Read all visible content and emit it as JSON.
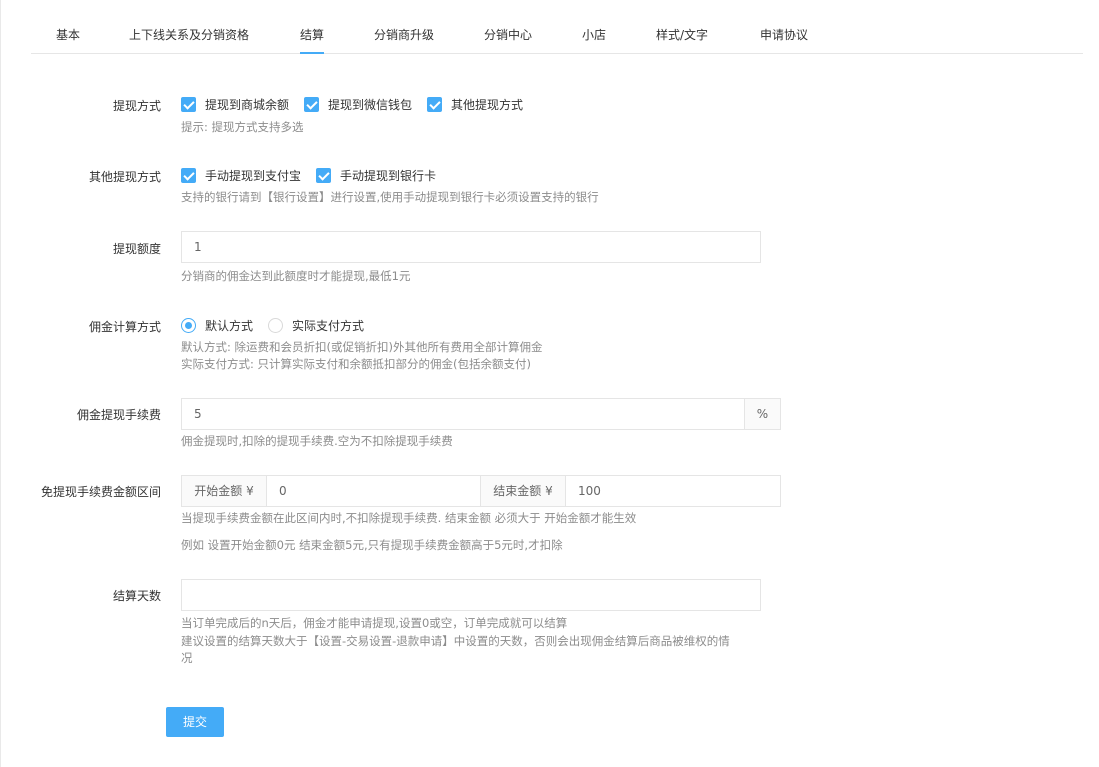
{
  "tabs": [
    {
      "label": "基本"
    },
    {
      "label": "上下线关系及分销资格"
    },
    {
      "label": "结算"
    },
    {
      "label": "分销商升级"
    },
    {
      "label": "分销中心"
    },
    {
      "label": "小店"
    },
    {
      "label": "样式/文字"
    },
    {
      "label": "申请协议"
    }
  ],
  "active_tab": "结算",
  "accent_color": "#44abf7",
  "form": {
    "withdraw_method": {
      "label": "提现方式",
      "options": [
        "提现到商城余额",
        "提现到微信钱包",
        "其他提现方式"
      ],
      "checked": [
        true,
        true,
        true
      ],
      "help": "提示: 提现方式支持多选"
    },
    "other_withdraw": {
      "label": "其他提现方式",
      "options": [
        "手动提现到支付宝",
        "手动提现到银行卡"
      ],
      "checked": [
        true,
        true
      ],
      "help": "支持的银行请到【银行设置】进行设置,使用手动提现到银行卡必须设置支持的银行"
    },
    "withdraw_amount": {
      "label": "提现额度",
      "value": "1",
      "help": "分销商的佣金达到此额度时才能提现,最低1元"
    },
    "commission_calc": {
      "label": "佣金计算方式",
      "options": [
        "默认方式",
        "实际支付方式"
      ],
      "selected": "默认方式",
      "help1": "默认方式: 除运费和会员折扣(或促销折扣)外其他所有费用全部计算佣金",
      "help2": "实际支付方式: 只计算实际支付和余额抵扣部分的佣金(包括余额支付)"
    },
    "withdraw_fee": {
      "label": "佣金提现手续费",
      "value": "5",
      "suffix": "%",
      "help": "佣金提现时,扣除的提现手续费.空为不扣除提现手续费"
    },
    "fee_free_range": {
      "label": "免提现手续费金额区间",
      "start_label": "开始金额 ¥",
      "start_value": "0",
      "end_label": "结束金额 ¥",
      "end_value": "100",
      "help1": "当提现手续费金额在此区间内时,不扣除提现手续费. 结束金额 必须大于 开始金额才能生效",
      "help2": "例如 设置开始金额0元 结束金额5元,只有提现手续费金额高于5元时,才扣除"
    },
    "settle_days": {
      "label": "结算天数",
      "value": "",
      "help1": "当订单完成后的n天后，佣金才能申请提现,设置0或空，订单完成就可以结算",
      "help2": "建议设置的结算天数大于【设置-交易设置-退款申请】中设置的天数，否则会出现佣金结算后商品被维权的情",
      "help3": "况"
    }
  },
  "submit_label": "提交"
}
